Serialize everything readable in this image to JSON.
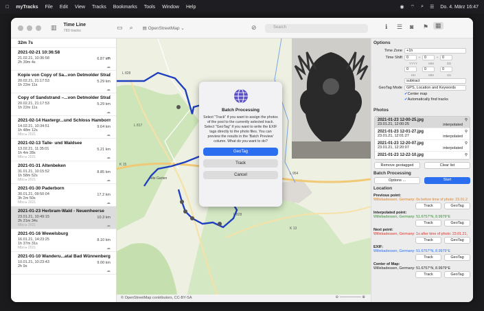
{
  "menubar": {
    "apple": "",
    "app": "myTracks",
    "items": [
      "File",
      "Edit",
      "View",
      "Tracks",
      "Bookmarks",
      "Tools",
      "Window",
      "Help"
    ],
    "datetime": "Do. 4. März 16:47"
  },
  "toolbar": {
    "title": "Time Line",
    "subtitle": "783 tracks",
    "map_source": "OpenStreetMap",
    "search_placeholder": "Search"
  },
  "tracks": [
    {
      "name": "32m 7s",
      "date": "",
      "duration": "",
      "distance": "",
      "partial": true
    },
    {
      "name": "2021-02-21 10:36:58",
      "date": "21.02.21, 10:36:58",
      "duration": "2h 39m 4s",
      "distance": "6.87 km"
    },
    {
      "name": "Kopie von Copy of Sa...von Detmolder Straße",
      "date": "20.02.21, 21:17:53",
      "duration": "1h 22m 11s",
      "distance": "5.29 km"
    },
    {
      "name": "Copy of Sandstrand –...von Detmolder Straße",
      "date": "20.02.21, 21:17:53",
      "duration": "1h 22m 11s",
      "distance": "5.29 km"
    },
    {
      "name": "2021-02-14 Haxtergr...und Schloss Hamborn",
      "date": "14.02.21, 10:34:51",
      "duration": "1h 48m 12s",
      "distance": "9.64 km",
      "badge": "Mbo ▸ 2021"
    },
    {
      "name": "2021-02-13 Talle- und Waldsee",
      "date": "13.02.21, 11:35:01",
      "duration": "1h 4m 28s",
      "distance": "5.21 km",
      "badge": "Mbo ▸ 2021"
    },
    {
      "name": "2021-01-31 Altenbeken",
      "date": "31.01.21, 10:15:52",
      "duration": "1h 58m 52s",
      "distance": "8.85 km",
      "badge": "Mbo ▸ 2021"
    },
    {
      "name": "2021-01-30 Paderborn",
      "date": "30.01.21, 09:50:04",
      "duration": "3h 2m 50s",
      "distance": "17.2 km",
      "badge": "Mbo ▸ 2021"
    },
    {
      "name": "2021-01-23 Herbram-Wald - Neuenheerse",
      "date": "23.01.21, 10:49:15",
      "duration": "2h 21m 34s",
      "distance": "10.3 km",
      "badge": "Mbo ▸ 2021",
      "selected": true
    },
    {
      "name": "2021-01-16 Wewelsburg",
      "date": "16.01.21, 14:23:25",
      "duration": "1h 37m 31s",
      "distance": "8.10 km",
      "badge": "Mbo ▸ 2021"
    },
    {
      "name": "2021-01-10 Wanderu...atal Bad Wünnenberg",
      "date": "10.01.21, 10:23:43",
      "duration": "2h 9s",
      "distance": "9.00 km"
    }
  ],
  "map": {
    "attribution": "© OpenStreetMap contributors, CC-BY-SA",
    "labels": [
      "L 828",
      "L 817",
      "K 15",
      "L 954",
      "K 13",
      "L 828"
    ],
    "town": "Alte Garten"
  },
  "modal": {
    "title": "Batch Processing",
    "message": "Select \"Track\" if you want to assign the photos of the pool to the currently selected track. Select \"GeoTag\" if you want to write the EXIF tags directly to the photo files. You can preview the results in the 'Batch Preview' column. What do you want to do?",
    "btn_geotag": "GeoTag",
    "btn_track": "Track",
    "btn_cancel": "Cancel"
  },
  "inspector": {
    "options_h": "Options",
    "timezone_l": "Time Zone",
    "timezone_v": "+1h",
    "timeshift_l": "Time Shift",
    "ts_values": [
      "0",
      "-",
      "0",
      "-",
      "0"
    ],
    "ts_units": [
      "YYYY",
      "MM",
      "DD"
    ],
    "ts2_values": [
      "0",
      "0",
      "0"
    ],
    "ts2_units": [
      "HH",
      "MM",
      "SS"
    ],
    "subtract": "subtract",
    "geotag_l": "GeoTag Mode",
    "geotag_v": "GPS, Location and Keywords",
    "center_map": "Center map",
    "auto_find": "Automatically find tracks",
    "photos_h": "Photos",
    "photos": [
      {
        "name": "2021-01-23 12-00-25.jpg",
        "date": "23.01.21, 12:00:25",
        "status": "interpolated",
        "selected": true
      },
      {
        "name": "2021-01-23 12-01-27.jpg",
        "date": "23.01.21, 12:01:27",
        "status": "interpolated"
      },
      {
        "name": "2021-01-23 12-20-07.jpg",
        "date": "23.01.21, 12:20:07",
        "status": "interpolated"
      },
      {
        "name": "2021-01-23 12-22-10.jpg",
        "date": "",
        "status": ""
      }
    ],
    "remove_geotagged": "Remove geotagged",
    "clear_list": "Clear list",
    "batch_h": "Batch Processing",
    "options_btn": "Options ...",
    "start_btn": "Start",
    "location_h": "Location",
    "prev_l": "Previous point:",
    "prev_v": "Willebadessen, Germany: 0s before time of photo: 23.01.2",
    "interp_l": "Interpolated point:",
    "interp_v": "Willebadessen, Germany: 51.6757°N, 8.9979°E",
    "next_l": "Next point:",
    "next_v": "Willebadessen, Germany: 1s after time of photo: 23.01.21,",
    "exif_l": "EXIF:",
    "exif_v": "Willebadessen, Germany: 51.6757°N, 8.9979°E",
    "center_l": "Center of Map:",
    "center_v": "Willebadessen, Germany: 51.6757°N, 8.9979°E",
    "track_btn": "Track",
    "geotag_btn": "GeoTag"
  },
  "colors": {
    "accent": "#2b6ff0",
    "route": "#1f3fbf",
    "prev": "#d9822b",
    "next": "#d9332b",
    "interp": "#3a8a3a",
    "exif": "#2b6ff0"
  }
}
